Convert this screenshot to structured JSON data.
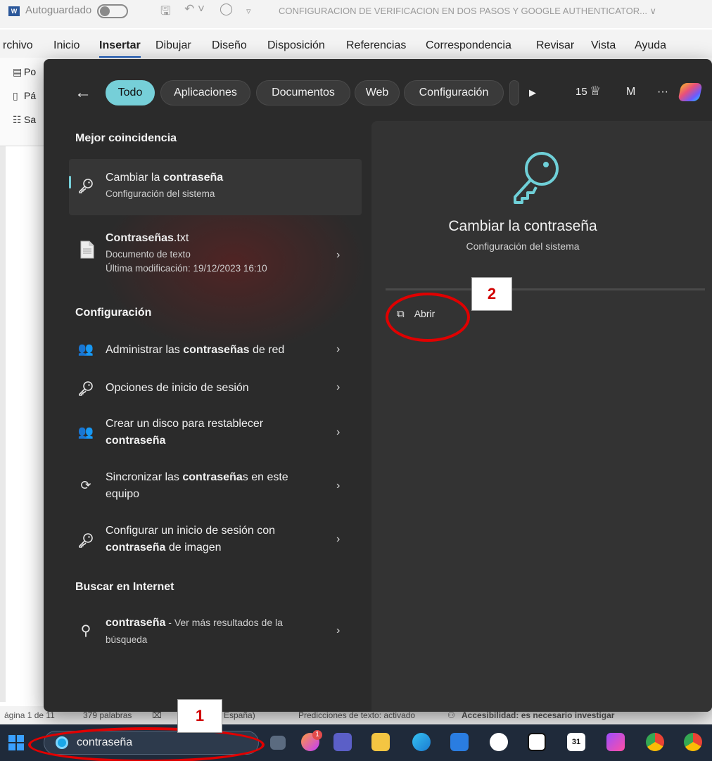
{
  "word": {
    "title_bar": {
      "autosave_label": "Autoguardado",
      "document_title": "CONFIGURACION DE VERIFICACION EN DOS PASOS Y GOOGLE AUTHENTICATOR... ∨"
    },
    "ribbon_tabs": [
      "rchivo",
      "Inicio",
      "Insertar",
      "Dibujar",
      "Diseño",
      "Disposición",
      "Referencias",
      "Correspondencia",
      "Revisar",
      "Vista",
      "Ayuda"
    ],
    "active_ribbon_tab": "Insertar",
    "ribbon_items": [
      "Po",
      "Pá",
      "Sa"
    ],
    "status_bar": {
      "page": "ágina 1 de 11",
      "words": "379 palabras",
      "language": "España)",
      "predictions": "Predicciones de texto: activado",
      "accessibility": "Accesibilidad: es necesario investigar"
    }
  },
  "search": {
    "filters": [
      "Todo",
      "Aplicaciones",
      "Documentos",
      "Web",
      "Configuración"
    ],
    "active_filter": "Todo",
    "points": "15",
    "avatar_initial": "M",
    "more_label": "···",
    "best_match_title": "Mejor coincidencia",
    "best_match": {
      "main_pre": "Cambiar la ",
      "main_bold": "contraseña",
      "sub": "Configuración del sistema"
    },
    "document_result": {
      "name_bold": "Contraseñas",
      "name_rest": ".txt",
      "type": "Documento de texto",
      "modified": "Última modificación: 19/12/2023 16:10"
    },
    "settings_title": "Configuración",
    "settings_items": [
      {
        "line1_pre": "Administrar las ",
        "line1_bold": "contraseñas",
        "line1_post": " de red"
      },
      {
        "line1_pre": "Opciones de inicio de sesión",
        "line1_bold": "",
        "line1_post": ""
      },
      {
        "line1_pre": "Crear un disco para restablecer",
        "line2_bold": "contraseña",
        "line2_post": ""
      },
      {
        "line1_pre": "Sincronizar las ",
        "line1_bold": "contraseña",
        "line1_post": "s en este",
        "line2_bold": "",
        "line2_post": "equipo"
      },
      {
        "line1_pre": "Configurar un inicio de sesión con",
        "line2_bold": "contraseña",
        "line2_post": " de imagen"
      }
    ],
    "web_title": "Buscar en Internet",
    "web_item": {
      "query": "contraseña",
      "rest": " - Ver más resultados de la",
      "line2": "búsqueda"
    },
    "detail": {
      "title": "Cambiar la contraseña",
      "subtitle": "Configuración del sistema",
      "open_label": "Abrir"
    },
    "taskbar_query": "contraseña"
  },
  "annotations": {
    "callout_1": "1",
    "callout_2": "2",
    "accent_red": "#e00000"
  },
  "taskbar": {
    "notification_badge": "1",
    "calendar_day": "31"
  }
}
